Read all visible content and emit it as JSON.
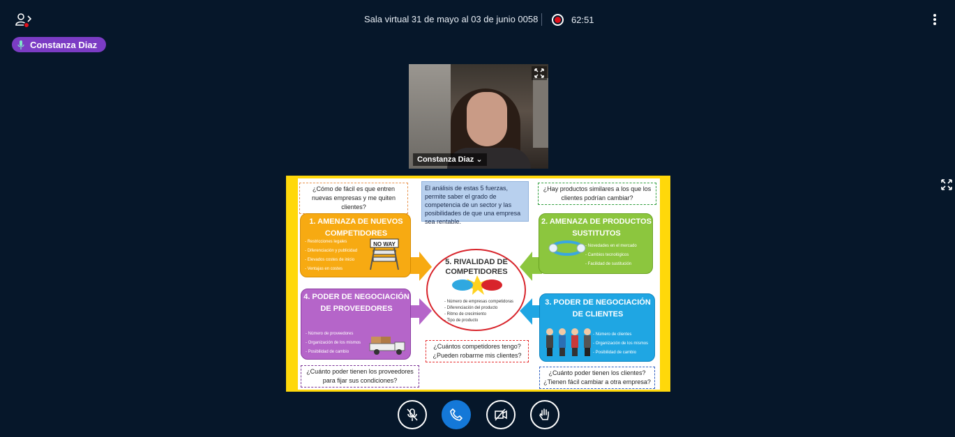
{
  "header": {
    "meeting_title": "Sala virtual 31 de mayo al 03 de junio 0058",
    "recording_time": "62:51"
  },
  "talking_indicator": {
    "name": "Constanza Diaz"
  },
  "webcam": {
    "name": "Constanza Diaz"
  },
  "slide": {
    "question_entrants": "¿Cómo de fácil es que entren nuevas empresas y me quiten clientes?",
    "intro_text": "El análisis de estas 5 fuerzas, permite saber el grado de competencia de un sector y las posibilidades de que una empresa sea rentable.",
    "question_substitutes": "¿Hay productos similares a los que los clientes podrían cambiar?",
    "box1_title": "1. AMENAZA DE NUEVOS COMPETIDORES",
    "box1_items": [
      "Restricciones legales",
      "Diferenciación y publicidad",
      "Elevados costes de inicio",
      "Ventajas en costes"
    ],
    "barrier_sign": "NO WAY",
    "box2_title": "2. AMENAZA DE PRODUCTOS SUSTITUTOS",
    "box2_items": [
      "Novedades en el mercado",
      "Cambios tecnológicos",
      "Facilidad de sustitución"
    ],
    "center_title": "5. RIVALIDAD DE COMPETIDORES",
    "center_items": [
      "Número de empresas competidoras",
      "Diferenciación del producto",
      "Ritmo de crecimiento",
      "Tipo de producto"
    ],
    "box3_title": "4. PODER DE NEGOCIACIÓN DE PROVEEDORES",
    "box3_items": [
      "Número de proveedores",
      "Organización de los mismos",
      "Posibilidad de cambio"
    ],
    "box4_title": "3. PODER DE NEGOCIACIÓN DE CLIENTES",
    "box4_items": [
      "Número de clientes",
      "Organización de los mismos",
      "Posibilidad de cambio"
    ],
    "question_competitors": "¿Cuántos competidores tengo? ¿Pueden robarme mis clientes?",
    "question_suppliers": "¿Cuánto poder tienen los proveedores para fijar sus condiciones?",
    "question_clients": "¿Cuánto poder tienen los clientes? ¿Tienen fácil cambiar a otra empresa?"
  },
  "colors": {
    "background": "#06172a",
    "recording": "#e0101a",
    "talker_badge": "#7b3cc4",
    "phone_button": "#1478d8",
    "slide_frame": "#ffd80a"
  },
  "icons": {
    "users": "users-icon",
    "options": "more-vertical-icon",
    "mic_muted": "mic-off-icon",
    "phone": "phone-icon",
    "video_off": "video-off-icon",
    "raise_hand": "hand-icon",
    "fullscreen": "fullscreen-icon"
  }
}
